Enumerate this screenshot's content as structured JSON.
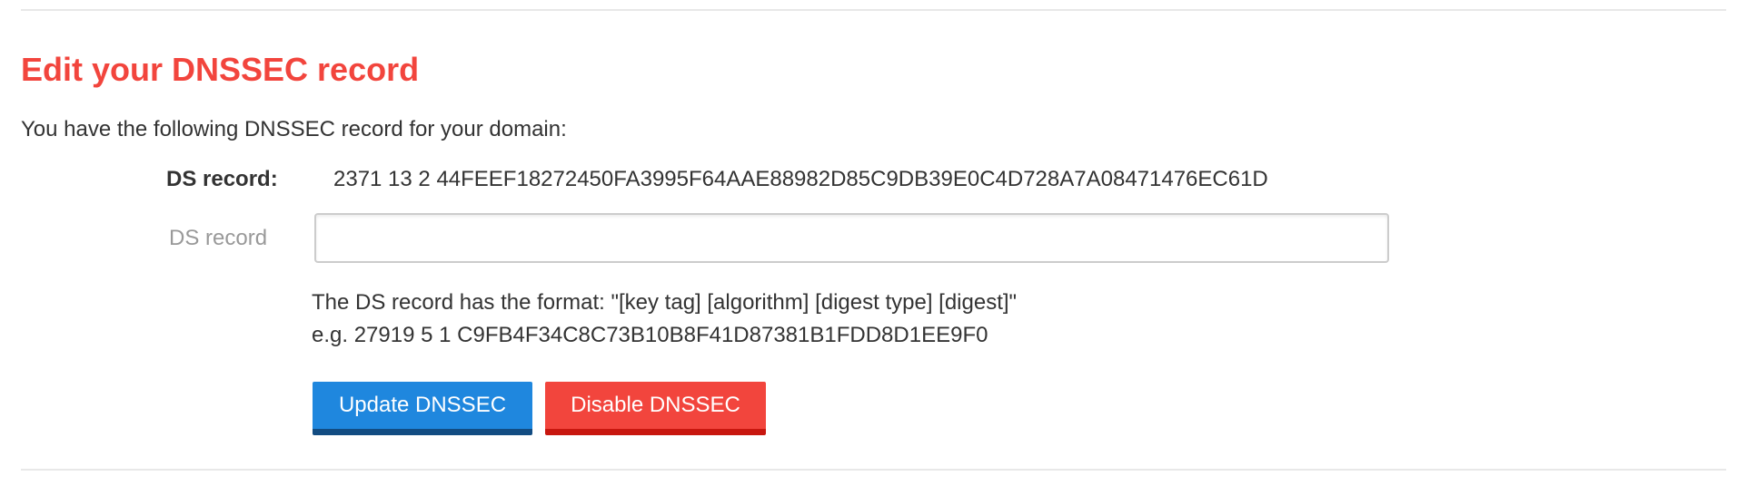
{
  "page": {
    "title": "Edit your DNSSEC record",
    "intro": "You have the following DNSSEC record for your domain:"
  },
  "existing_record": {
    "label": "DS record:",
    "value": "2371 13 2 44FEEF18272450FA3995F64AAE88982D85C9DB39E0C4D728A7A08471476EC61D"
  },
  "ds_field": {
    "label": "DS record",
    "value": "",
    "placeholder": ""
  },
  "help": {
    "format": "The DS record has the format: \"[key tag] [algorithm] [digest type] [digest]\"",
    "example": "e.g. 27919 5 1 C9FB4F34C8C73B10B8F41D87381B1FDD8D1EE9F0"
  },
  "buttons": {
    "update_label": "Update DNSSEC",
    "disable_label": "Disable DNSSEC"
  },
  "colors": {
    "title": "#f2453d",
    "update_button": "#1f87de",
    "disable_button": "#f2453d"
  }
}
